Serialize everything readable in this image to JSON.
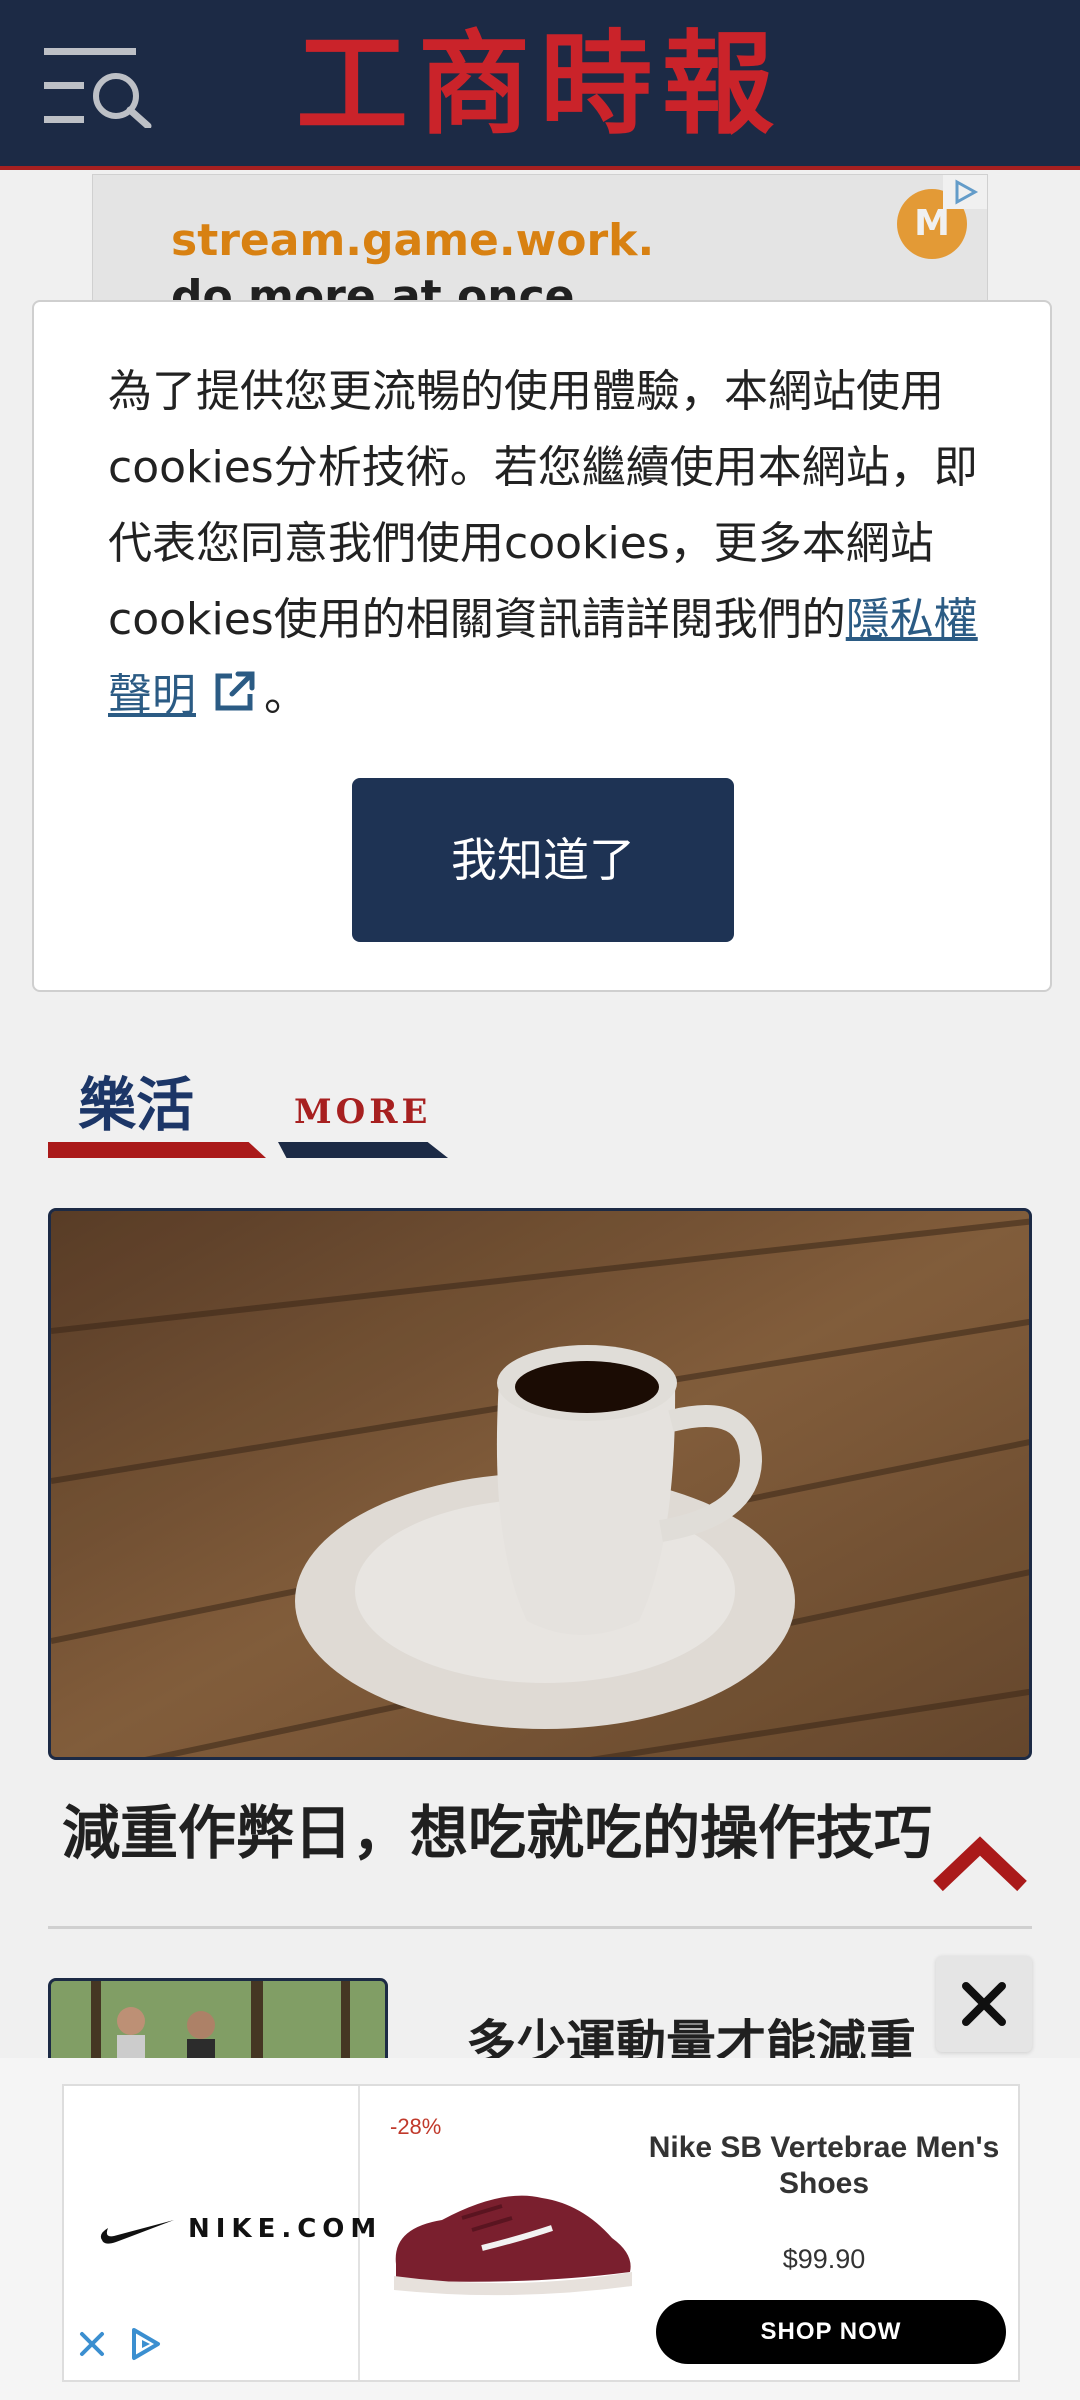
{
  "header": {
    "logo_text": "工商時報",
    "menu_icon": "menu-search-icon",
    "background": "#1e2d4a",
    "accent": "#d7262d"
  },
  "top_ad": {
    "line1": "stream.game.work.",
    "line2": "do more at once",
    "badge": "M",
    "adchoices_icon": "adchoices-icon"
  },
  "cookie_modal": {
    "message": "為了提供您更流暢的使用體驗，本網站使用cookies分析技術。若您繼續使用本網站，即代表您同意我們使用cookies，更多本網站cookies使用的相關資訊請詳閱我們的",
    "privacy_link": "隱私權聲明",
    "link_icon": "external-link-icon",
    "end_punct": "。",
    "accept_button": "我知道了",
    "button_color": "#1e3354"
  },
  "section": {
    "title": "樂活",
    "more_label": "MORE"
  },
  "articles": [
    {
      "title": "減重作弊日，想吃就吃的操作技巧",
      "image": "coffee-cup-photo"
    },
    {
      "title": "多少運動量才能減重",
      "image": "runners-photo"
    }
  ],
  "floating": {
    "back_to_top_icon": "chevron-up-icon",
    "close_icon": "close-icon"
  },
  "bottom_ad": {
    "brand": "NIKE.COM",
    "discount": "-28%",
    "product_name": "Nike SB Vertebrae Men's Shoes",
    "price": "$99.90",
    "cta": "SHOP NOW",
    "close_icon": "close-icon",
    "adchoices_icon": "adchoices-icon"
  }
}
